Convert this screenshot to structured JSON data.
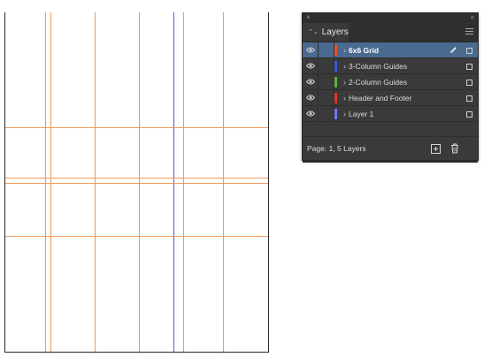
{
  "panel": {
    "close_glyph": "×",
    "collapse_glyph": "‹‹",
    "tab_arrows": "⌃⌄",
    "tab_label": "Layers",
    "menu_icon": "panel-menu-icon"
  },
  "layers": [
    {
      "name": "6x6 Grid",
      "color": "#e0582b",
      "selected": true,
      "visible": true
    },
    {
      "name": "3-Column Guides",
      "color": "#3a5bd6",
      "selected": false,
      "visible": true
    },
    {
      "name": "2-Column Guides",
      "color": "#5fb23a",
      "selected": false,
      "visible": true
    },
    {
      "name": "Header and Footer",
      "color": "#d93a2a",
      "selected": false,
      "visible": true
    },
    {
      "name": "Layer 1",
      "color": "#6f78f2",
      "selected": false,
      "visible": true
    }
  ],
  "footer": {
    "status": "Page: 1, 5 Layers",
    "new_layer_icon": "new-layer-icon",
    "delete_icon": "trash-icon"
  },
  "colors": {
    "guide_orange": "#ef9a5c",
    "guide_blue": "#5a55e8",
    "selection": "#4a6a8f"
  }
}
